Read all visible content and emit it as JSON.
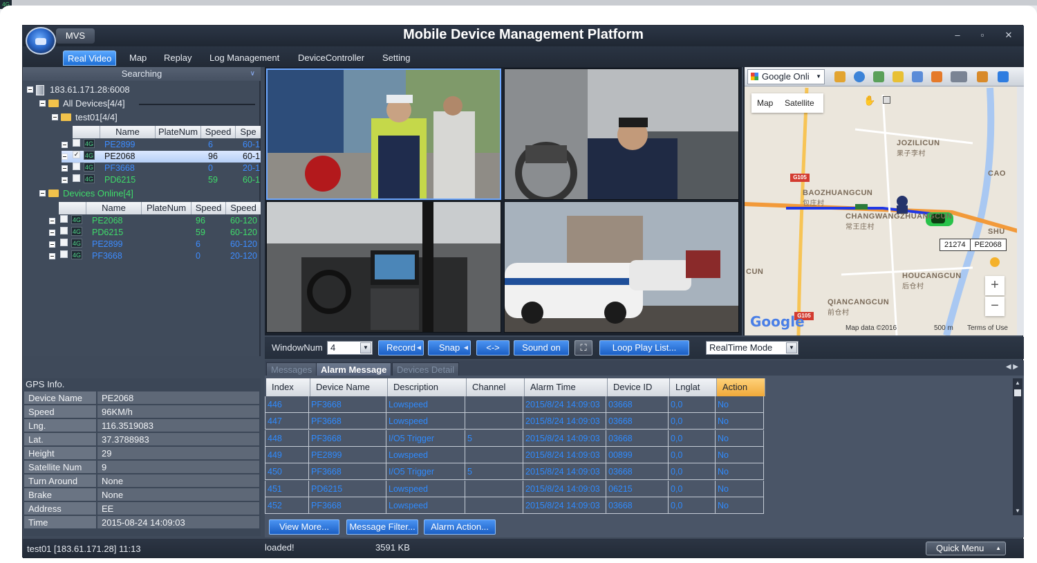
{
  "window": {
    "app_badge": "MVS",
    "title": "Mobile Device Management Platform",
    "controls": [
      "–",
      "▫",
      "✕"
    ]
  },
  "menu": [
    {
      "label": "Real Video",
      "active": true
    },
    {
      "label": "Map"
    },
    {
      "label": "Replay"
    },
    {
      "label": "Log Management"
    },
    {
      "label": "DeviceController"
    },
    {
      "label": "Setting"
    }
  ],
  "tree": {
    "search_label": "Searching",
    "server": "183.61.171.28:6008",
    "all_devices": "All Devices[4/4]",
    "group": "test01[4/4]",
    "group_columns": [
      "Name",
      "PlateNum",
      "Speed",
      "Spe"
    ],
    "group_rows": [
      {
        "name": "PE2899",
        "plate": "",
        "speed": "6",
        "extra": "60-1",
        "status": "4G",
        "selected": false
      },
      {
        "name": "PE2068",
        "plate": "",
        "speed": "96",
        "extra": "60-1",
        "status": "4G",
        "selected": true
      },
      {
        "name": "PF3668",
        "plate": "",
        "speed": "0",
        "extra": "20-1",
        "status": "4G",
        "selected": false
      },
      {
        "name": "PD6215",
        "plate": "",
        "speed": "59",
        "extra": "60-1",
        "status": "4G",
        "selected": false
      }
    ],
    "online": "Devices Online[4]",
    "online_columns": [
      "Name",
      "PlateNum",
      "Speed",
      "Speed"
    ],
    "online_rows": [
      {
        "name": "PE2068",
        "plate": "",
        "speed": "96",
        "extra": "60-120",
        "status": "4G"
      },
      {
        "name": "PD6215",
        "plate": "",
        "speed": "59",
        "extra": "60-120",
        "status": "4G"
      },
      {
        "name": "PE2899",
        "plate": "",
        "speed": "6",
        "extra": "60-120",
        "status": "4G"
      },
      {
        "name": "PF3668",
        "plate": "",
        "speed": "0",
        "extra": "20-120",
        "status": "4G"
      }
    ]
  },
  "gps": {
    "title": "GPS Info.",
    "rows": [
      {
        "k": "Device Name",
        "v": "PE2068"
      },
      {
        "k": "Speed",
        "v": "96KM/h"
      },
      {
        "k": "Lng.",
        "v": "116.3519083"
      },
      {
        "k": "Lat.",
        "v": "37.3788983"
      },
      {
        "k": "Height",
        "v": "29"
      },
      {
        "k": "Satellite Num",
        "v": "9"
      },
      {
        "k": "Turn Around",
        "v": "None"
      },
      {
        "k": "Brake",
        "v": "None"
      },
      {
        "k": "Address",
        "v": "EE"
      },
      {
        "k": "Time",
        "v": "2015-08-24 14:09:03"
      }
    ]
  },
  "map": {
    "provider": "Google Onli",
    "type_map": "Map",
    "type_satellite": "Satellite",
    "labels": [
      {
        "en": "JOZILICUN",
        "cn": "果子李村"
      },
      {
        "en": "BAOZHUANGCUN",
        "cn": "包庄村"
      },
      {
        "en": "CHANGWANGZHUANGCUN",
        "cn": "常王庄村"
      },
      {
        "en": "HOUCANGCUN",
        "cn": "后仓村"
      },
      {
        "en": "QIANCANGCUN",
        "cn": "前仓村"
      },
      {
        "en": "CAO",
        "cn": ""
      },
      {
        "en": "SHU",
        "cn": ""
      },
      {
        "en": "CUN",
        "cn": ""
      }
    ],
    "road_shield": "G105",
    "car_tag_id": "21274",
    "car_tag_name": "PE2068",
    "google": "Google",
    "map_data": "Map data ©2016",
    "scale": "500 m",
    "terms": "Terms of Use",
    "zoom_in": "+",
    "zoom_out": "−"
  },
  "video_bar": {
    "window_num_label": "WindowNum",
    "window_num_value": "4",
    "record": "Record",
    "snap": "Snap",
    "swap": "<->",
    "sound": "Sound on",
    "loop": "Loop Play List...",
    "mode": "RealTime Mode"
  },
  "messages": {
    "tabs": [
      "Messages",
      "Alarm Message",
      "Devices Detail"
    ],
    "columns": [
      "Index",
      "Device Name",
      "Description",
      "Channel",
      "Alarm Time",
      "Device ID",
      "Lnglat",
      "Action"
    ],
    "rows": [
      [
        "446",
        "PF3668",
        "Lowspeed",
        "",
        "2015/8/24 14:09:03",
        "03668",
        "0,0",
        "No"
      ],
      [
        "447",
        "PF3668",
        "Lowspeed",
        "",
        "2015/8/24 14:09:03",
        "03668",
        "0,0",
        "No"
      ],
      [
        "448",
        "PF3668",
        "I/O5 Trigger",
        "5",
        "2015/8/24 14:09:03",
        "03668",
        "0,0",
        "No"
      ],
      [
        "449",
        "PE2899",
        "Lowspeed",
        "",
        "2015/8/24 14:09:03",
        "00899",
        "0,0",
        "No"
      ],
      [
        "450",
        "PF3668",
        "I/O5 Trigger",
        "5",
        "2015/8/24 14:09:03",
        "03668",
        "0,0",
        "No"
      ],
      [
        "451",
        "PD6215",
        "Lowspeed",
        "",
        "2015/8/24 14:09:03",
        "06215",
        "0,0",
        "No"
      ],
      [
        "452",
        "PF3668",
        "Lowspeed",
        "",
        "2015/8/24 14:09:03",
        "03668",
        "0,0",
        "No"
      ]
    ],
    "buttons": [
      "View More...",
      "Message Filter...",
      "Alarm Action..."
    ]
  },
  "status": {
    "user": "test01 [183.61.171.28] 11:13",
    "loaded": "loaded!",
    "size": "3591 KB",
    "quick_menu": "Quick Menu"
  },
  "colors": {
    "accent": "#1d6fd6",
    "panel": "#404b5b",
    "link_blue": "#2f8bff",
    "online_green": "#3fdc6a",
    "action_header": "#f0a93a"
  }
}
